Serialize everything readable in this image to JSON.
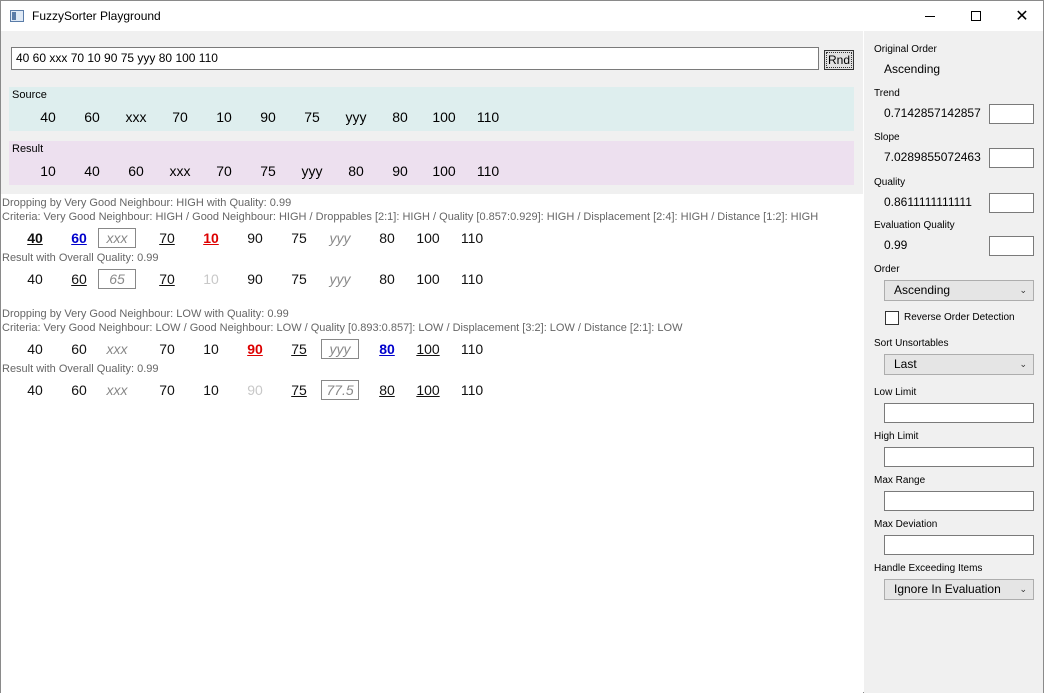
{
  "window": {
    "title": "FuzzySorter Playground"
  },
  "input": {
    "value": "40 60 xxx 70 10 90 75 yyy 80 100 110",
    "rnd_label": "Rnd"
  },
  "source": {
    "label": "Source",
    "values": [
      "40",
      "60",
      "xxx",
      "70",
      "10",
      "90",
      "75",
      "yyy",
      "80",
      "100",
      "110"
    ]
  },
  "result": {
    "label": "Result",
    "values": [
      "10",
      "40",
      "60",
      "xxx",
      "70",
      "75",
      "yyy",
      "80",
      "90",
      "100",
      "110"
    ]
  },
  "analysis_high": {
    "heading": "Dropping by Very Good Neighbour: HIGH with Quality: 0.99",
    "criteria": "Criteria: Very Good Neighbour: HIGH / Good Neighbour: HIGH / Droppables [2:1]: HIGH / Quality [0.857:0.929]: HIGH / Displacement [2:4]: HIGH / Distance [1:2]: HIGH",
    "row1": [
      "40",
      "60",
      "xxx",
      "70",
      "10",
      "90",
      "75",
      "yyy",
      "80",
      "100",
      "110"
    ],
    "result_heading": "Result with Overall Quality: 0.99",
    "row2": [
      "40",
      "60",
      "65",
      "70",
      "10",
      "90",
      "75",
      "yyy",
      "80",
      "100",
      "110"
    ]
  },
  "analysis_low": {
    "heading": "Dropping by Very Good Neighbour: LOW with Quality: 0.99",
    "criteria": "Criteria: Very Good Neighbour: LOW / Good Neighbour: LOW / Quality [0.893:0.857]: LOW / Displacement [3:2]: LOW / Distance [2:1]: LOW",
    "row1": [
      "40",
      "60",
      "xxx",
      "70",
      "10",
      "90",
      "75",
      "yyy",
      "80",
      "100",
      "110"
    ],
    "result_heading": "Result with Overall Quality: 0.99",
    "row2": [
      "40",
      "60",
      "xxx",
      "70",
      "10",
      "90",
      "75",
      "77.5",
      "80",
      "100",
      "110"
    ]
  },
  "panel": {
    "original_order_label": "Original Order",
    "original_order_value": "Ascending",
    "trend_label": "Trend",
    "trend_value": "0.7142857142857",
    "slope_label": "Slope",
    "slope_value": "7.0289855072463",
    "quality_label": "Quality",
    "quality_value": "0.8611111111111",
    "eval_quality_label": "Evaluation Quality",
    "eval_quality_value": "0.99",
    "order_label": "Order",
    "order_value": "Ascending",
    "reverse_label": "Reverse Order Detection",
    "sort_unsortables_label": "Sort Unsortables",
    "sort_unsortables_value": "Last",
    "low_limit_label": "Low Limit",
    "high_limit_label": "High Limit",
    "max_range_label": "Max Range",
    "max_deviation_label": "Max Deviation",
    "handle_exceeding_label": "Handle Exceeding Items",
    "handle_exceeding_value": "Ignore In Evaluation"
  }
}
